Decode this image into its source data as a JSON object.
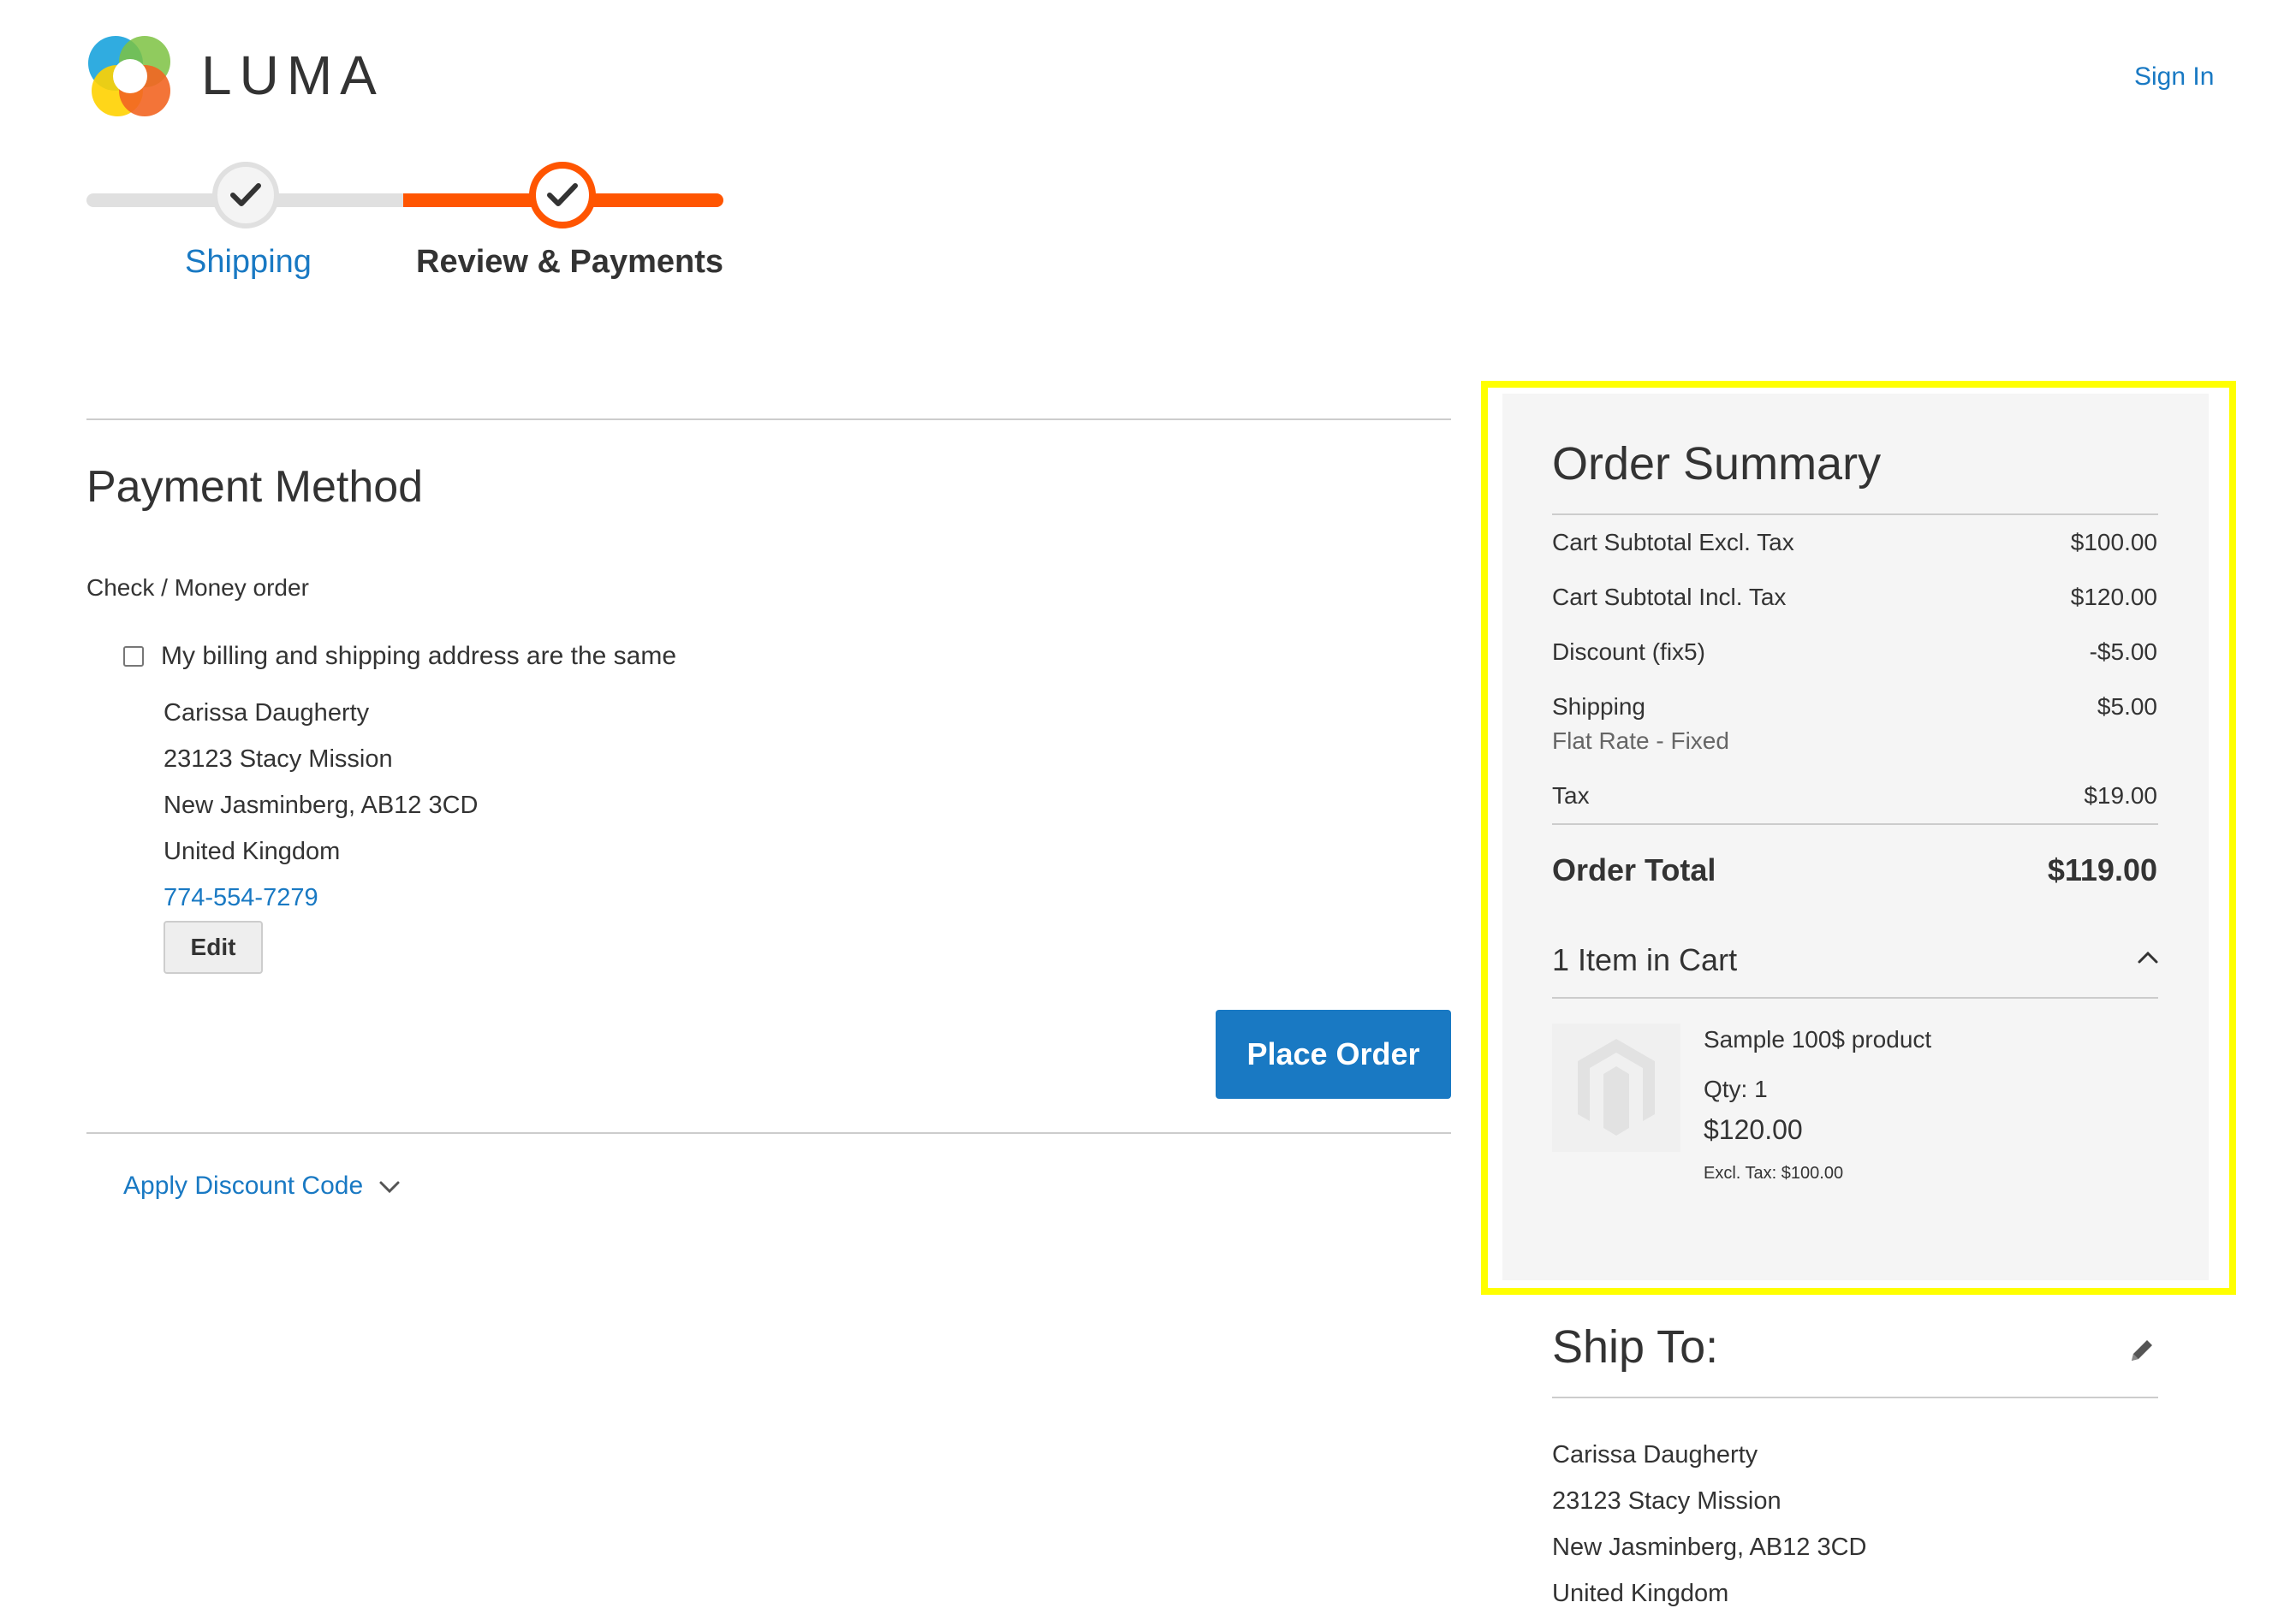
{
  "header": {
    "logo_text": "LUMA",
    "sign_in": "Sign In"
  },
  "progress": {
    "steps": [
      {
        "label": "Shipping",
        "state": "complete"
      },
      {
        "label": "Review & Payments",
        "state": "active"
      }
    ]
  },
  "payment": {
    "title": "Payment Method",
    "method": "Check / Money order",
    "same_address_label": "My billing and shipping address are the same",
    "same_address_checked": false,
    "address": [
      "Carissa Daugherty",
      "23123 Stacy Mission",
      "New Jasminberg, AB12 3CD",
      "United Kingdom"
    ],
    "phone": "774-554-7279",
    "edit_label": "Edit",
    "place_order_label": "Place Order"
  },
  "discount": {
    "label": "Apply Discount Code"
  },
  "summary": {
    "title": "Order Summary",
    "rows": [
      {
        "label": "Cart Subtotal Excl. Tax",
        "value": "$100.00"
      },
      {
        "label": "Cart Subtotal Incl. Tax",
        "value": "$120.00"
      },
      {
        "label": "Discount (fix5)",
        "value": "-$5.00"
      },
      {
        "label": "Shipping",
        "value": "$5.00",
        "sub": "Flat Rate - Fixed"
      },
      {
        "label": "Tax",
        "value": "$19.00"
      }
    ],
    "total_label": "Order Total",
    "total_value": "$119.00",
    "items_count": "1 Item in Cart",
    "item": {
      "name": "Sample 100$ product",
      "qty": "Qty: 1",
      "price": "$120.00",
      "excl_tax": "Excl. Tax: $100.00"
    }
  },
  "ship_to": {
    "title": "Ship To:",
    "address": [
      "Carissa Daugherty",
      "23123 Stacy Mission",
      "New Jasminberg, AB12 3CD",
      "United Kingdom"
    ]
  },
  "colors": {
    "accent_blue": "#1979c3",
    "progress_orange": "#ff5501",
    "highlight_yellow": "#ffff00"
  }
}
